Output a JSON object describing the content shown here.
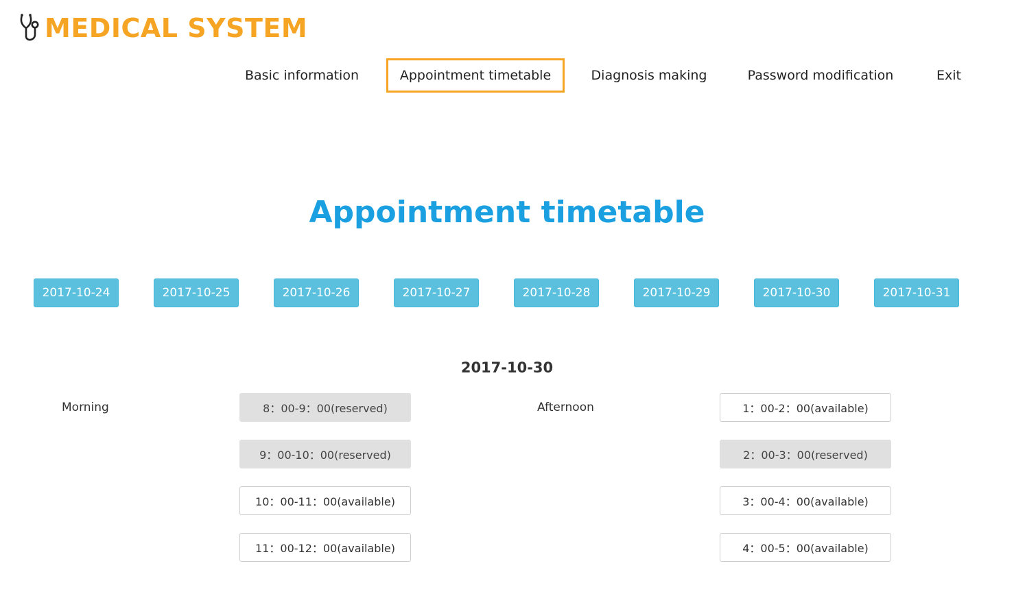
{
  "header": {
    "logo_icon": "stethoscope-icon",
    "logo_text": "MEDICAL SYSTEM",
    "brand_color": "#f5a523"
  },
  "nav": {
    "items": [
      {
        "label": "Basic information",
        "active": false
      },
      {
        "label": "Appointment timetable",
        "active": true
      },
      {
        "label": "Diagnosis making",
        "active": false
      },
      {
        "label": "Password modification",
        "active": false
      },
      {
        "label": "Exit",
        "active": false
      }
    ]
  },
  "page": {
    "title": "Appointment timetable",
    "title_color": "#1aa0e0"
  },
  "dates": [
    "2017-10-24",
    "2017-10-25",
    "2017-10-26",
    "2017-10-27",
    "2017-10-28",
    "2017-10-29",
    "2017-10-30",
    "2017-10-31"
  ],
  "date_button_color": "#5bc0de",
  "schedule": {
    "selected_date": "2017-10-30",
    "morning": {
      "label": "Morning",
      "slots": [
        {
          "label": "8：00-9：00(reserved)",
          "status": "reserved"
        },
        {
          "label": "9：00-10：00(reserved)",
          "status": "reserved"
        },
        {
          "label": "10：00-11：00(available)",
          "status": "available"
        },
        {
          "label": "11：00-12：00(available)",
          "status": "available"
        }
      ]
    },
    "afternoon": {
      "label": "Afternoon",
      "slots": [
        {
          "label": "1：00-2：00(available)",
          "status": "available"
        },
        {
          "label": "2：00-3：00(reserved)",
          "status": "reserved"
        },
        {
          "label": "3：00-4：00(available)",
          "status": "available"
        },
        {
          "label": "4：00-5：00(available)",
          "status": "available"
        }
      ]
    }
  }
}
